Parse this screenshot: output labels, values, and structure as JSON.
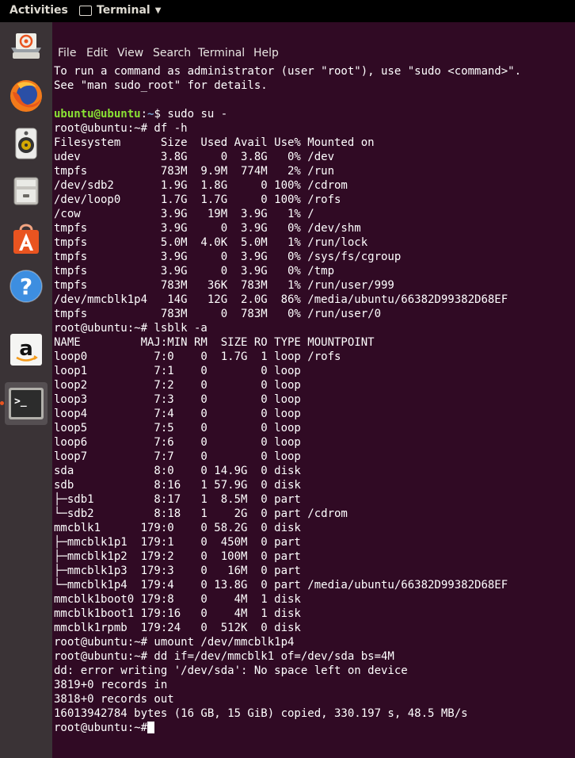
{
  "topbar": {
    "activities": "Activities",
    "app_name": "Terminal"
  },
  "launcher": {
    "items": [
      {
        "name": "files-icon"
      },
      {
        "name": "firefox-icon"
      },
      {
        "name": "rhythmbox-icon"
      },
      {
        "name": "file-cabinet-icon"
      },
      {
        "name": "software-center-icon"
      },
      {
        "name": "help-icon"
      },
      {
        "name": "amazon-icon",
        "text": "a"
      },
      {
        "name": "terminal-icon",
        "text": ">_"
      }
    ]
  },
  "menubar": {
    "items": [
      "File",
      "Edit",
      "View",
      "Search",
      "Terminal",
      "Help"
    ]
  },
  "terminal": {
    "lines": [
      "To run a command as administrator (user \"root\"), use \"sudo <command>\".",
      "See \"man sudo_root\" for details.",
      "",
      {
        "user": "ubuntu@ubuntu",
        "path": "~",
        "sym": "$",
        "cmd": " sudo su -"
      },
      "root@ubuntu:~# df -h",
      "Filesystem      Size  Used Avail Use% Mounted on",
      "udev            3.8G     0  3.8G   0% /dev",
      "tmpfs           783M  9.9M  774M   2% /run",
      "/dev/sdb2       1.9G  1.8G     0 100% /cdrom",
      "/dev/loop0      1.7G  1.7G     0 100% /rofs",
      "/cow            3.9G   19M  3.9G   1% /",
      "tmpfs           3.9G     0  3.9G   0% /dev/shm",
      "tmpfs           5.0M  4.0K  5.0M   1% /run/lock",
      "tmpfs           3.9G     0  3.9G   0% /sys/fs/cgroup",
      "tmpfs           3.9G     0  3.9G   0% /tmp",
      "tmpfs           783M   36K  783M   1% /run/user/999",
      "/dev/mmcblk1p4   14G   12G  2.0G  86% /media/ubuntu/66382D99382D68EF",
      "tmpfs           783M     0  783M   0% /run/user/0",
      "root@ubuntu:~# lsblk -a",
      "NAME         MAJ:MIN RM  SIZE RO TYPE MOUNTPOINT",
      "loop0          7:0    0  1.7G  1 loop /rofs",
      "loop1          7:1    0        0 loop",
      "loop2          7:2    0        0 loop",
      "loop3          7:3    0        0 loop",
      "loop4          7:4    0        0 loop",
      "loop5          7:5    0        0 loop",
      "loop6          7:6    0        0 loop",
      "loop7          7:7    0        0 loop",
      "sda            8:0    0 14.9G  0 disk",
      "sdb            8:16   1 57.9G  0 disk",
      "├─sdb1         8:17   1  8.5M  0 part",
      "└─sdb2         8:18   1    2G  0 part /cdrom",
      "mmcblk1      179:0    0 58.2G  0 disk",
      "├─mmcblk1p1  179:1    0  450M  0 part",
      "├─mmcblk1p2  179:2    0  100M  0 part",
      "├─mmcblk1p3  179:3    0   16M  0 part",
      "└─mmcblk1p4  179:4    0 13.8G  0 part /media/ubuntu/66382D99382D68EF",
      "mmcblk1boot0 179:8    0    4M  1 disk",
      "mmcblk1boot1 179:16   0    4M  1 disk",
      "mmcblk1rpmb  179:24   0  512K  0 disk",
      "root@ubuntu:~# umount /dev/mmcblk1p4",
      "root@ubuntu:~# dd if=/dev/mmcblk1 of=/dev/sda bs=4M",
      "dd: error writing '/dev/sda': No space left on device",
      "3819+0 records in",
      "3818+0 records out",
      "16013942784 bytes (16 GB, 15 GiB) copied, 330.197 s, 48.5 MB/s",
      {
        "prompt": "root@ubuntu:~#",
        "cursor": true
      }
    ]
  }
}
